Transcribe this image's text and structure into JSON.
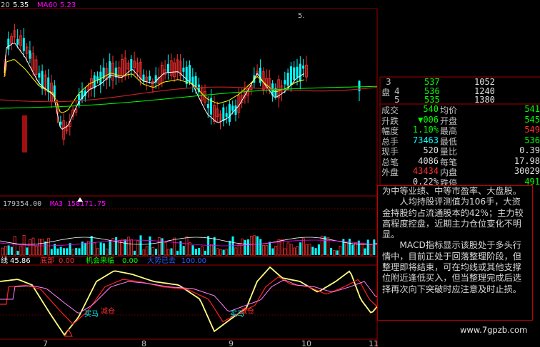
{
  "top_bar": {
    "date_fragment": "20",
    "price": "5.35",
    "ma_label": "MA60",
    "ma_value": "5.23",
    "right_value": "5."
  },
  "volume_header": {
    "value": "179354.00",
    "ma3_label": "MA3",
    "ma3_value": "158171.75"
  },
  "indicator_header": {
    "line_label": "线",
    "line_value": "45.86",
    "bottom_label": "底部",
    "bottom_value": "0.00",
    "chance_label": "机会来临",
    "chance_value": "0.00",
    "sell_label": "大势已去",
    "sell_value": "100.00"
  },
  "chart_annotations": {
    "buy_labels": [
      "买马",
      "减仓",
      "买马",
      "减仓"
    ]
  },
  "x_axis": {
    "ticks": [
      "7",
      "8",
      "9",
      "10",
      "11"
    ]
  },
  "order_book": {
    "side_label": "盘",
    "rows": [
      {
        "level": "3",
        "price": "537",
        "volume": "1052"
      },
      {
        "level": "4",
        "price": "536",
        "volume": "1240"
      },
      {
        "level": "5",
        "price": "535",
        "volume": "1380"
      }
    ]
  },
  "quote_stats": [
    {
      "label": "成交",
      "value": "540",
      "label2": "均价",
      "value2": "541",
      "vcolor": "#00ff00",
      "v2color": "#00ff00"
    },
    {
      "label": "升跌",
      "value": "▼006",
      "label2": "开盘",
      "value2": "545",
      "vcolor": "#00ff00",
      "v2color": "#00ff00"
    },
    {
      "label": "幅度",
      "value": "1.10%",
      "label2": "最高",
      "value2": "549",
      "vcolor": "#00ff00",
      "v2color": "#ff3030"
    },
    {
      "label": "总手",
      "value": "73463",
      "label2": "最低",
      "value2": "536",
      "vcolor": "#00ffff",
      "v2color": "#00ff00"
    },
    {
      "label": "现手",
      "value": "520",
      "label2": "量比",
      "value2": "0.39",
      "vcolor": "#e0e0e0",
      "v2color": "#e0e0e0"
    },
    {
      "label": "总笔",
      "value": "4086",
      "label2": "每笔",
      "value2": "17.98",
      "vcolor": "#e0e0e0",
      "v2color": "#e0e0e0"
    },
    {
      "label": "外盘",
      "value": "43434",
      "label2": "内盘",
      "value2": "30029",
      "vcolor": "#ff3030",
      "v2color": "#e0e0e0"
    },
    {
      "label": "",
      "value": "0.22%",
      "label2": "跌停",
      "value2": "491",
      "vcolor": "#e0e0e0",
      "v2color": "#00ff00"
    }
  ],
  "commentary": {
    "p1": "为中等业绩、中等市盈率、大盘股。",
    "p2": "人均持股评测值为106手，大资金持股约占流通股本的42%；主力较高程度控盘，近期主力仓位变化不明显。",
    "p3": "MACD指标显示该股处于多头行情中，目前正处于回落整理阶段，但整理即将结束，可在均线或其他支撑位附近逢低买入，但当整理完成后选择再次向下突破时应注意及时止损。"
  },
  "watermark": "www.7gpzb.com",
  "colors": {
    "up": "#ff3030",
    "down": "#00ffff",
    "ma_short": "#ffffff",
    "ma_mid": "#ffff00",
    "ma_long1": "#ff00ff",
    "ma_long2": "#00ff00",
    "panel_border": "#c00000"
  }
}
